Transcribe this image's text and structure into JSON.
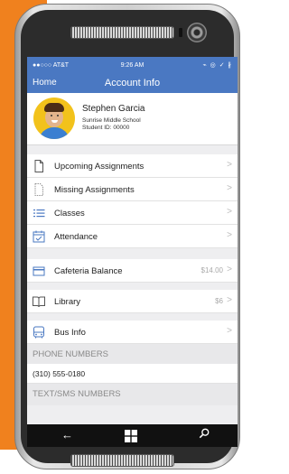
{
  "status_bar": {
    "carrier": "●●○○○ AT&T",
    "time": "9:26 AM",
    "indicators": "⌁ ◎ ✓ ∦"
  },
  "nav": {
    "back_label": "Home",
    "title": "Account Info"
  },
  "profile": {
    "name": "Stephen Garcia",
    "school": "Sunrise Middle School",
    "student_id": "Student ID: 00000"
  },
  "menu_group_1": [
    {
      "label": "Upcoming Assignments",
      "icon": "document-icon"
    },
    {
      "label": "Missing Assignments",
      "icon": "document-outline-icon"
    },
    {
      "label": "Classes",
      "icon": "list-icon"
    },
    {
      "label": "Attendance",
      "icon": "calendar-check-icon"
    }
  ],
  "cafeteria": {
    "label": "Cafeteria Balance",
    "value": "$14.00",
    "icon": "card-icon"
  },
  "library": {
    "label": "Library",
    "value": "$6",
    "icon": "book-icon"
  },
  "bus": {
    "label": "Bus Info",
    "icon": "bus-icon"
  },
  "phone_section": {
    "header": "PHONE NUMBERS",
    "number": "(310) 555-0180"
  },
  "sms_section": {
    "header": "TEXT/SMS NUMBERS"
  },
  "chevron": ">",
  "colors": {
    "accent_orange": "#f0811e",
    "nav_blue": "#4a78c2"
  }
}
